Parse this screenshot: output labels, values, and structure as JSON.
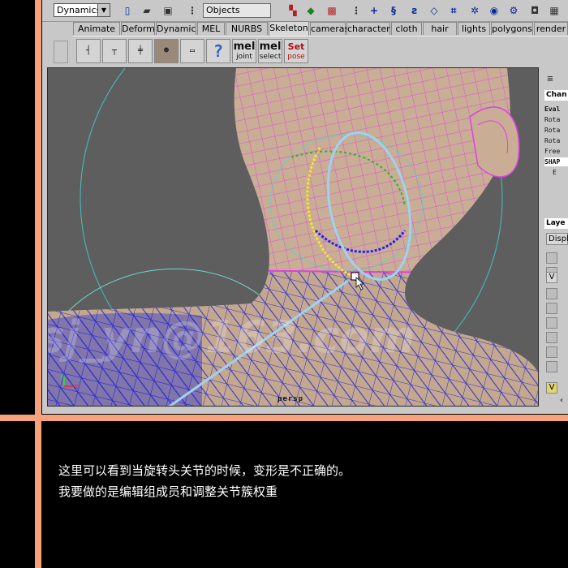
{
  "status_line": {
    "menu_set": "Dynamics",
    "selection_mode": "Objects"
  },
  "shelf_tabs": [
    {
      "label": "Animate"
    },
    {
      "label": "Deform"
    },
    {
      "label": "Dynamic"
    },
    {
      "label": "MEL"
    },
    {
      "label": "NURBS"
    },
    {
      "label": "Skeleton",
      "active": true
    },
    {
      "label": "cameras"
    },
    {
      "label": "character"
    },
    {
      "label": "cloth"
    },
    {
      "label": "hair"
    },
    {
      "label": "lights"
    },
    {
      "label": "polygons"
    },
    {
      "label": "render"
    }
  ],
  "shelf": {
    "help_glyph": "?",
    "mel_joint_top": "mel",
    "mel_joint_sub": "joint",
    "mel_select_top": "mel",
    "mel_select_sub": "select",
    "set_pose_top": "Set",
    "set_pose_sub": "pose"
  },
  "viewport": {
    "camera_label": "persp",
    "axis_y": "Y",
    "axis_x": "X",
    "watermark": "dsj_yn@163.com"
  },
  "channel_box": {
    "header": "Chan",
    "rows": [
      "Eval",
      "Rota",
      "Rota",
      "Rota",
      "Free",
      "SHAP",
      "E"
    ]
  },
  "layer_editor": {
    "header": "Laye",
    "display_button": "Displ",
    "visible_marks": [
      "V",
      "V"
    ]
  },
  "caption": {
    "line1": "这里可以看到当旋转头关节的时候，变形是不正确的。",
    "line2": "我要做的是编辑组成员和调整关节簇权重"
  },
  "colors": {
    "frame": "#f6a27c",
    "viewport_bg": "#5e5e5e",
    "wire_magenta": "#e23ee6",
    "wire_blue": "#2a2ad8",
    "skin": "#c9ad95",
    "annotation": "#9fd2ec"
  }
}
